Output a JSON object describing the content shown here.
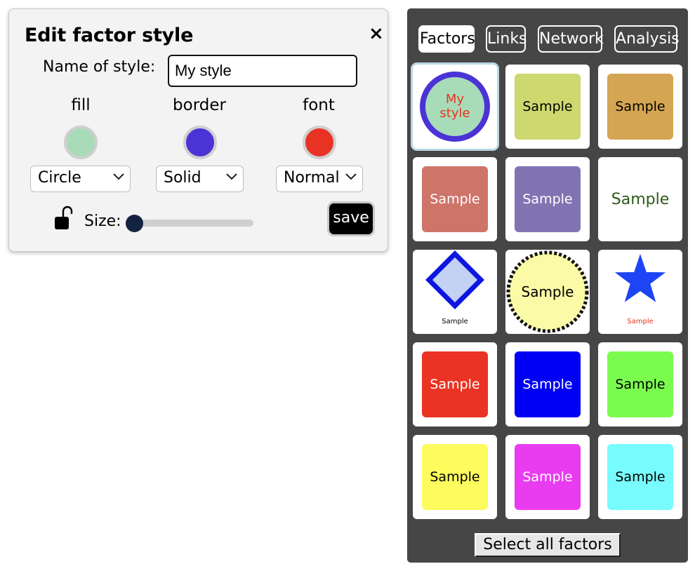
{
  "dialog": {
    "title": "Edit factor style",
    "close_glyph": "×",
    "name_label": "Name of style:",
    "name_value": "My style",
    "fill_label": "fill",
    "border_label": "border",
    "font_label": "font",
    "fill_color": "#a8dcb8",
    "border_color": "#4b33d6",
    "font_color": "#e83223",
    "shape_value": "Circle",
    "border_style_value": "Solid",
    "font_style_value": "Normal",
    "lock_icon": "unlocked-padlock-icon",
    "size_label": "Size:",
    "size_value": 0,
    "save_label": "save"
  },
  "panel": {
    "tabs": [
      {
        "label": "Factors",
        "active": true
      },
      {
        "label": "Links",
        "active": false
      },
      {
        "label": "Network",
        "active": false
      },
      {
        "label": "Analysis",
        "active": false
      }
    ],
    "tiles": [
      {
        "label": "My\nstyle",
        "kind": "circle-bordered",
        "fill": "#a8dcb8",
        "border": "#4b33d6",
        "text": "#e83223",
        "selected": true
      },
      {
        "label": "Sample",
        "kind": "square",
        "fill": "#cdd86f",
        "text": "#000000"
      },
      {
        "label": "Sample",
        "kind": "square",
        "fill": "#d4a552",
        "text": "#000000"
      },
      {
        "label": "Sample",
        "kind": "square",
        "fill": "#cf7469",
        "text": "#ffffff"
      },
      {
        "label": "Sample",
        "kind": "square",
        "fill": "#8274b3",
        "text": "#ffffff"
      },
      {
        "label": "Sample",
        "kind": "plain",
        "fill": "#ffffff",
        "text": "#2d5a17"
      },
      {
        "label": "Sample",
        "kind": "diamond",
        "fill": "#c3d1f5",
        "border": "#0c16e0",
        "text": "#000000"
      },
      {
        "label": "Sample",
        "kind": "circle-dashed",
        "fill": "#fbfba7",
        "border": "#111111",
        "text": "#000000"
      },
      {
        "label": "Sample",
        "kind": "star",
        "fill": "#1d45f5",
        "text": "#e83223"
      },
      {
        "label": "Sample",
        "kind": "square",
        "fill": "#ea3323",
        "text": "#ffffff"
      },
      {
        "label": "Sample",
        "kind": "square",
        "fill": "#0000f5",
        "text": "#ffffff"
      },
      {
        "label": "Sample",
        "kind": "square",
        "fill": "#7cfb4f",
        "text": "#000000"
      },
      {
        "label": "Sample",
        "kind": "square",
        "fill": "#fdfb5d",
        "text": "#000000"
      },
      {
        "label": "Sample",
        "kind": "square",
        "fill": "#e93cf0",
        "text": "#ffffff"
      },
      {
        "label": "Sample",
        "kind": "square",
        "fill": "#77fbfd",
        "text": "#000000"
      }
    ],
    "select_all_label": "Select all factors"
  }
}
